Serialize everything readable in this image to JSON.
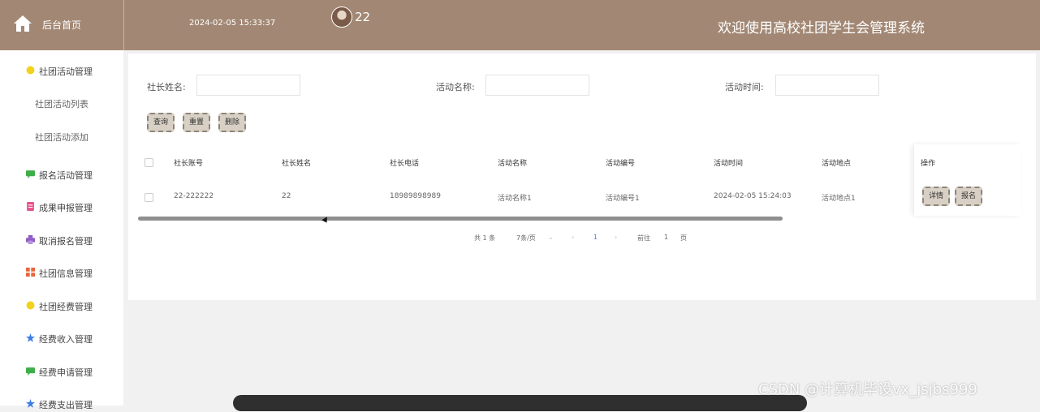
{
  "header": {
    "home_label": "后台首页",
    "datetime": "2024-02-05 15:33:37",
    "username": "22",
    "site_title": "欢迎使用高校社团学生会管理系统",
    "bg_color": "#a28874"
  },
  "sidebar": {
    "items": [
      {
        "label": "社团活动管理",
        "icon": "circle-yellow-icon"
      },
      {
        "label": "报名活动管理",
        "icon": "chat-green-icon"
      },
      {
        "label": "成果申报管理",
        "icon": "doc-pink-icon"
      },
      {
        "label": "取消报名管理",
        "icon": "printer-purple-icon"
      },
      {
        "label": "社团信息管理",
        "icon": "grid-orange-icon"
      },
      {
        "label": "社团经费管理",
        "icon": "circle-yellow-icon"
      },
      {
        "label": "经费收入管理",
        "icon": "star-blue-icon"
      },
      {
        "label": "经费申请管理",
        "icon": "chat-green-icon"
      },
      {
        "label": "经费支出管理",
        "icon": "star-blue-icon"
      }
    ],
    "subitems": [
      "社团活动列表",
      "社团活动添加"
    ]
  },
  "search": {
    "leader_name_label": "社长姓名:",
    "activity_name_label": "活动名称:",
    "activity_time_label": "活动时间:",
    "leader_name_value": "",
    "activity_name_value": "",
    "activity_time_value": "",
    "query_label": "查询",
    "reset_label": "重置",
    "delete_label": "删除"
  },
  "table": {
    "headers": [
      "社长账号",
      "社长姓名",
      "社长电话",
      "活动名称",
      "活动编号",
      "活动时间",
      "活动地点",
      "操作"
    ],
    "rows": [
      {
        "cells": [
          "22-222222",
          "22",
          "18989898989",
          "活动名称1",
          "活动编号1",
          "2024-02-05 15:24:03",
          "活动地点1"
        ],
        "detail_label": "详情",
        "signup_label": "报名"
      }
    ]
  },
  "pagination": {
    "total": "共 1 条",
    "page_size": "7条/页",
    "current_page": "1",
    "goto_label": "前往",
    "goto_value": "1",
    "page_suffix": "页"
  },
  "watermark": "CSDN @计算机毕设vx_jsjbs999"
}
